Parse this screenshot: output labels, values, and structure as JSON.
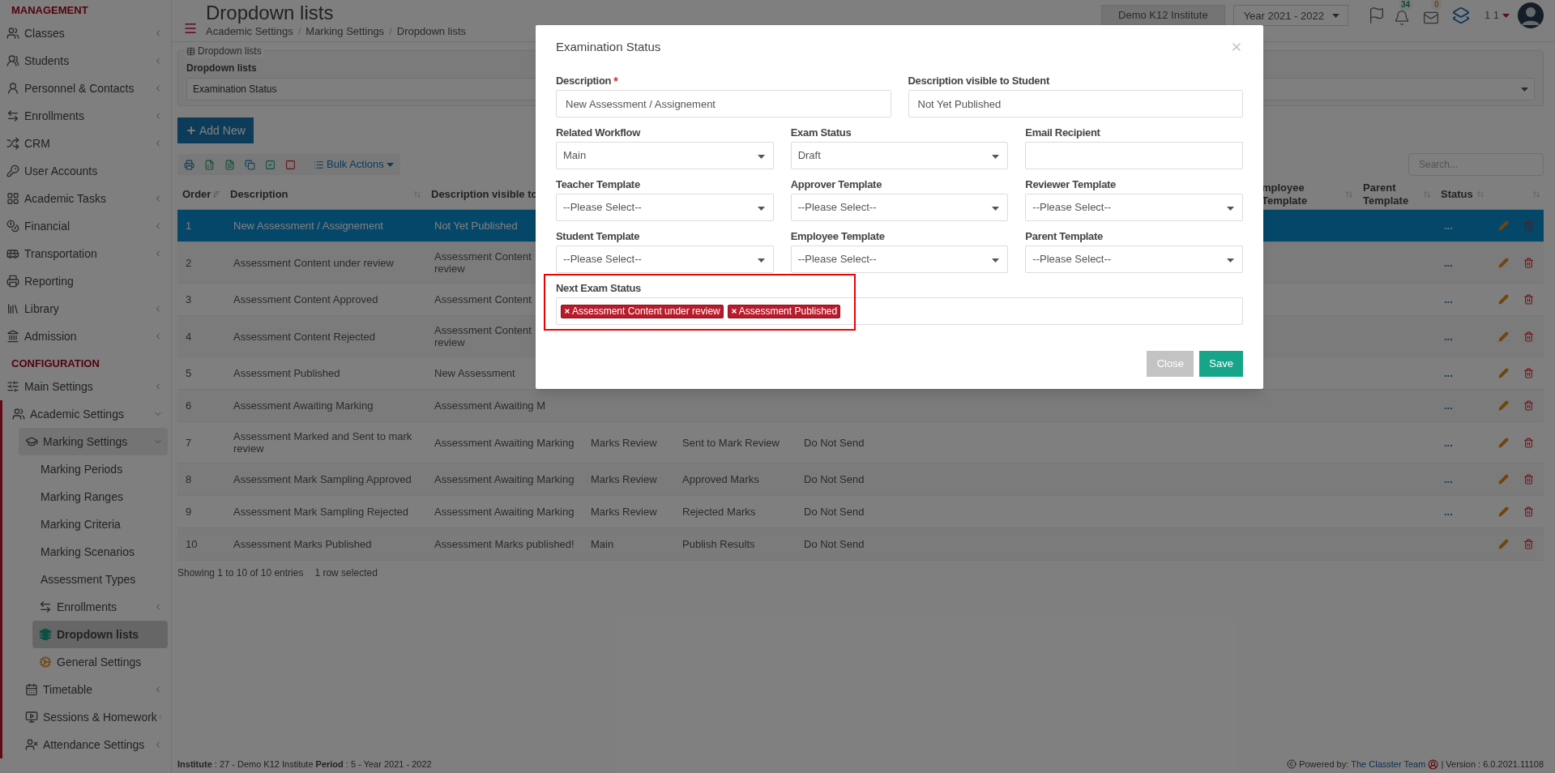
{
  "sidebar": {
    "sections": [
      {
        "heading": "MANAGEMENT",
        "items": [
          {
            "label": "Classes",
            "selected": false,
            "expanded": false
          },
          {
            "label": "Students",
            "selected": false,
            "expanded": false
          },
          {
            "label": "Personnel & Contacts",
            "selected": false,
            "expanded": false
          },
          {
            "label": "Enrollments",
            "selected": false,
            "expanded": false
          },
          {
            "label": "CRM",
            "selected": false,
            "expanded": false
          },
          {
            "label": "User Accounts",
            "selected": false
          },
          {
            "label": "Academic Tasks",
            "selected": false,
            "expanded": false
          },
          {
            "label": "Financial",
            "selected": false,
            "expanded": false
          },
          {
            "label": "Transportation",
            "selected": false,
            "expanded": false
          },
          {
            "label": "Reporting",
            "selected": false
          },
          {
            "label": "Library",
            "selected": false,
            "expanded": false
          },
          {
            "label": "Admission",
            "selected": false,
            "expanded": false
          }
        ]
      },
      {
        "heading": "CONFIGURATION",
        "items": [
          {
            "label": "Main Settings",
            "selected": false,
            "expanded": false
          },
          {
            "label": "Academic Settings",
            "selected": false,
            "expanded": true,
            "children": [
              {
                "label": "Marking Settings",
                "selected": false,
                "expanded": true,
                "children": [
                  {
                    "label": "Marking Periods",
                    "selected": false
                  },
                  {
                    "label": "Marking Ranges",
                    "selected": false
                  },
                  {
                    "label": "Marking Criteria",
                    "selected": false
                  },
                  {
                    "label": "Marking Scenarios",
                    "selected": false
                  },
                  {
                    "label": "Assessment Types",
                    "selected": false
                  },
                  {
                    "label": "Enrollments",
                    "selected": false,
                    "expanded": false
                  },
                  {
                    "label": "Dropdown lists",
                    "selected": true
                  },
                  {
                    "label": "General Settings",
                    "selected": false
                  }
                ]
              },
              {
                "label": "Timetable",
                "selected": false,
                "expanded": false
              },
              {
                "label": "Sessions & Homework",
                "selected": false,
                "expanded": false
              },
              {
                "label": "Attendance Settings",
                "selected": false,
                "expanded": false
              }
            ]
          }
        ]
      }
    ]
  },
  "header": {
    "title": "Dropdown lists",
    "breadcrumbs": [
      "Academic Settings",
      "Marking Settings",
      "Dropdown lists"
    ],
    "breadcrumb_separators": [
      "/",
      "/"
    ],
    "institute": "Demo K12 Institute",
    "year": "Year 2021 - 2022",
    "notifications": "34",
    "messages": "0",
    "user": "1 1"
  },
  "panel": {
    "legend": "Dropdown lists",
    "label": "Dropdown lists",
    "value": "Examination Status"
  },
  "toolbar": {
    "add_button": "Add New",
    "bulk_actions": "Bulk Actions",
    "search_placeholder": "Search..."
  },
  "table": {
    "header": {
      "order": "Order",
      "description": "Description",
      "visible_to_student": "Description visible to",
      "employee_template": "mployee\nTemplate",
      "parent_template": "Parent\nTemplate",
      "status": "Status"
    },
    "rows": [
      {
        "order": "1",
        "description": "New Assessment / Assignement",
        "visible_to_student": "Not Yet Published",
        "status": "...",
        "selected": true
      },
      {
        "order": "2",
        "description": "Assessment Content under review",
        "visible_to_student": "Assessment Content\nreview",
        "status": "...",
        "selected": false
      },
      {
        "order": "3",
        "description": "Assessment Content Approved",
        "visible_to_student": "Assessment Content",
        "status": "...",
        "selected": false
      },
      {
        "order": "4",
        "description": "Assessment Content Rejected",
        "visible_to_student": "Assessment Content\nreview",
        "status": "...",
        "selected": false
      },
      {
        "order": "5",
        "description": "Assessment Published",
        "visible_to_student": "New Assessment",
        "status": "...",
        "selected": false
      },
      {
        "order": "6",
        "description": "Assessment Awaiting Marking",
        "visible_to_student": "Assessment Awaiting M",
        "status": "...",
        "selected": false
      },
      {
        "order": "7",
        "description": "Assessment Marked and Sent to mark review",
        "visible_to_student": "Assessment Awaiting Marking",
        "related_workflow": "Marks Review",
        "exam_status": "Sent to Mark Review",
        "email_recipient": "Do Not Send",
        "status": "...",
        "selected": false
      },
      {
        "order": "8",
        "description": "Assessment Mark Sampling Approved",
        "visible_to_student": "Assessment Awaiting Marking",
        "related_workflow": "Marks Review",
        "exam_status": "Approved Marks",
        "email_recipient": "Do Not Send",
        "status": "...",
        "selected": false
      },
      {
        "order": "9",
        "description": "Assessment Mark Sampling Rejected",
        "visible_to_student": "Assessment Awaiting Marking",
        "related_workflow": "Marks Review",
        "exam_status": "Rejected Marks",
        "email_recipient": "Do Not Send",
        "status": "...",
        "selected": false
      },
      {
        "order": "10",
        "description": "Assessment Marks Published",
        "visible_to_student": "Assessment Marks published!",
        "related_workflow": "Main",
        "exam_status": "Publish Results",
        "email_recipient": "Do Not Send",
        "selected": false
      }
    ],
    "info": "Showing 1 to 10 of 10 entries",
    "selection_info": "1 row selected"
  },
  "status_bar": {
    "left": "**Institute** : 27 - Demo K12 Institute **Period** : 5 - Year 2021 - 2022",
    "powered_by": "Powered by:",
    "team": "The Classter Team",
    "version": "| Version : 6.0.2021.11108"
  },
  "modal": {
    "title": "Examination Status",
    "rows": [
      [
        {
          "label": "Description",
          "required_mark": "*",
          "kind": "text",
          "value": "New Assessment / Assignement"
        },
        {
          "label": "Description visible to Student",
          "kind": "text",
          "value": "Not Yet Published"
        }
      ],
      [
        {
          "label": "Related Workflow",
          "kind": "select",
          "value": "Main"
        },
        {
          "label": "Exam Status",
          "kind": "select",
          "value": "Draft"
        },
        {
          "label": "Email Recipient",
          "kind": "text"
        }
      ],
      [
        {
          "label": "Teacher Template",
          "kind": "select",
          "value": "--Please Select--"
        },
        {
          "label": "Approver Template",
          "kind": "select",
          "value": "--Please Select--"
        },
        {
          "label": "Reviewer Template",
          "kind": "select",
          "value": "--Please Select--"
        }
      ],
      [
        {
          "label": "Student Template",
          "kind": "select",
          "value": "--Please Select--"
        },
        {
          "label": "Employee Template",
          "kind": "select",
          "value": "--Please Select--"
        },
        {
          "label": "Parent Template",
          "kind": "select",
          "value": "--Please Select--"
        }
      ]
    ],
    "next_status": {
      "label": "Next Exam Status",
      "highlighted": true,
      "tags": [
        "Assessment Content under review",
        "Assessment Published"
      ]
    },
    "buttons": [
      {
        "label": "Close",
        "kind": "secondary"
      },
      {
        "label": "Save",
        "kind": "primary"
      }
    ]
  }
}
